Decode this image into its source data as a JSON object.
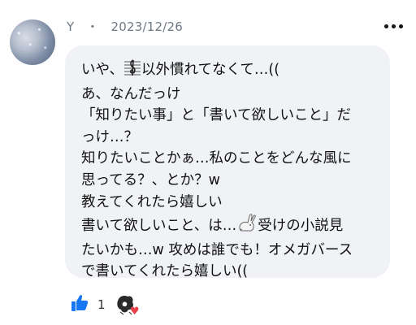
{
  "comment": {
    "author": "Y",
    "separator": "・",
    "date": "2023/12/26",
    "lines": [
      {
        "before": "いや、",
        "icon": "music-staff-icon",
        "after": "以外慣れてなくて…(("
      },
      {
        "text": "あ、なんだっけ"
      },
      {
        "text": "「知りたい事」と「書いて欲しいこと」だ"
      },
      {
        "text": "っけ…？"
      },
      {
        "text": "知りたいことかぁ…私のことをどんな風に"
      },
      {
        "text": "思ってる？、とか？w"
      },
      {
        "text": "教えてくれたら嬉しい"
      },
      {
        "before": "書いて欲しいこと、は…",
        "icon": "rabbit-icon",
        "after": "受けの小説見"
      },
      {
        "text": "たいかも…w 攻めは誰でも！オメガバース"
      },
      {
        "text": "で書いてくれたら嬉しい(("
      }
    ]
  },
  "reactions": {
    "like_count": "1",
    "like_icon": "thumbs-up-icon",
    "reactor_icon": "reactor-avatar-icon",
    "badge_icon": "heart-icon",
    "colors": {
      "like": "#1877f2",
      "heart": "#e8414a"
    }
  }
}
